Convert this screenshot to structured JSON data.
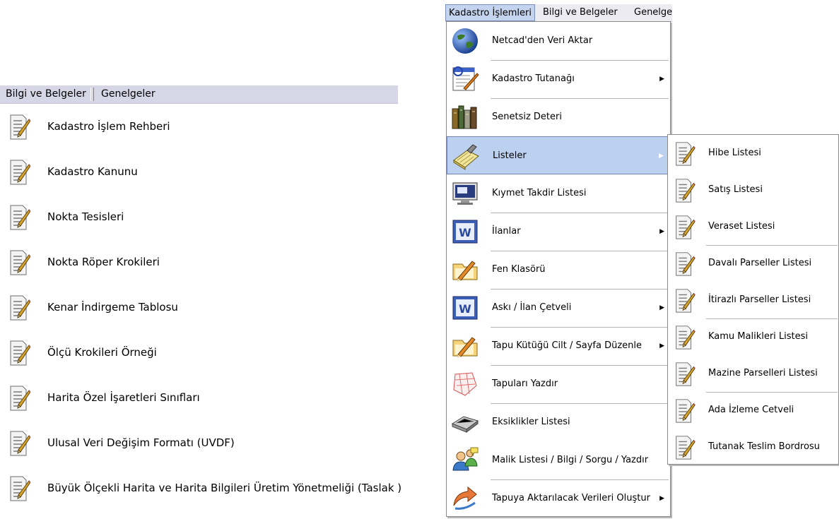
{
  "left_panel": {
    "menubar": {
      "bilgi": "Bilgi ve Belgeler",
      "genelgeler": "Genelgeler"
    },
    "items": [
      {
        "label": "Kadastro İşlem Rehberi"
      },
      {
        "label": "Kadastro Kanunu"
      },
      {
        "label": "Nokta Tesisleri"
      },
      {
        "label": "Nokta Röper Krokileri"
      },
      {
        "label": "Kenar İndirgeme Tablosu"
      },
      {
        "label": "Ölçü Krokileri Örneği"
      },
      {
        "label": "Harita Özel İşaretleri Sınıfları"
      },
      {
        "label": "Ulusal Veri Değişim Formatı (UVDF)"
      },
      {
        "label": "Büyük Ölçekli Harita ve Harita Bilgileri Üretim Yönetmeliği (Taslak )"
      }
    ],
    "item_icon": "document-pencil-icon"
  },
  "menubar": {
    "kadastro": "Kadastro İşlemleri",
    "bilgi": "Bilgi ve Belgeler",
    "genelgeler": "Genelge"
  },
  "kadastro_menu": {
    "items": [
      {
        "label": "Netcad'den Veri Aktar",
        "icon": "globe-icon",
        "submenu": false
      },
      {
        "label": "Kadastro Tutanağı",
        "icon": "form-pencil-icon",
        "submenu": true
      },
      {
        "label": "Senetsiz Deteri",
        "icon": "books-icon",
        "submenu": false
      },
      {
        "label": "Listeler",
        "icon": "notebook-icon",
        "submenu": true,
        "highlighted": true
      },
      {
        "label": "Kıymet Takdir Listesi",
        "icon": "monitor-icon",
        "submenu": false
      },
      {
        "label": "İlanlar",
        "icon": "word-document-icon",
        "submenu": true
      },
      {
        "label": "Fen Klasörü",
        "icon": "folder-pencil-icon",
        "submenu": false
      },
      {
        "label": "Askı / İlan Çetveli",
        "icon": "word-document-icon",
        "submenu": true
      },
      {
        "label": "Tapu Kütüğü Cilt / Sayfa Düzenle",
        "icon": "folder-pencil-icon",
        "submenu": true
      },
      {
        "label": "Tapuları Yazdır",
        "icon": "map-icon",
        "submenu": false
      },
      {
        "label": "Eksiklikler Listesi",
        "icon": "tray-icon",
        "submenu": false
      },
      {
        "label": "Malik Listesi / Bilgi / Sorgu / Yazdır",
        "icon": "users-icon",
        "submenu": false
      },
      {
        "label": "Tapuya Aktarılacak Verileri Oluştur",
        "icon": "transfer-icon",
        "submenu": true
      }
    ]
  },
  "listeler_submenu": {
    "items": [
      {
        "label": "Hibe Listesi"
      },
      {
        "label": "Satış Listesi"
      },
      {
        "label": "Veraset Listesi"
      },
      {
        "label": "Davalı Parseller Listesi"
      },
      {
        "label": "İtirazlı Parseller Listesi"
      },
      {
        "label": "Kamu Malikleri Listesi"
      },
      {
        "label": "Mazine Parselleri Listesi"
      },
      {
        "label": "Ada İzleme Cetveli"
      },
      {
        "label": "Tutanak Teslim Bordrosu"
      }
    ],
    "item_icon": "document-pencil-icon"
  },
  "colors": {
    "highlight": "#bcd0f0",
    "menubar": "#ecebf2",
    "left_menubar": "#d6d6e6"
  }
}
